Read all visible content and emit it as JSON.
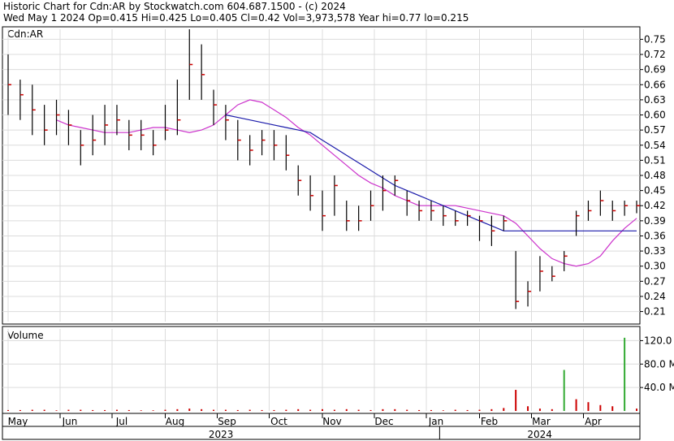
{
  "header": {
    "line1": "Historic Chart for Cdn:AR by Stockwatch.com 604.687.1500 - (c) 2024",
    "line2": "Wed May  1 2024   Op=0.415  Hi=0.425  Lo=0.405  Cl=0.42  Vol=3,973,578  Year hi=0.77  lo=0.215"
  },
  "price_panel": {
    "label": "Cdn:AR"
  },
  "volume_panel": {
    "label": "Volume"
  },
  "colors": {
    "bar_up": "#000000",
    "close_tick": "#cc0000",
    "ma_short": "#cc33cc",
    "ma_long": "#1a1aaa",
    "volume_bar": "#cc0000",
    "volume_spike": "#33aa33",
    "grid": "#dcdcdc"
  },
  "chart_data": [
    {
      "type": "ohlc",
      "title": "Historic Chart for Cdn:AR",
      "ylim": [
        0.19,
        0.77
      ],
      "yticks": [
        0.21,
        0.24,
        0.27,
        0.3,
        0.33,
        0.36,
        0.39,
        0.42,
        0.45,
        0.48,
        0.51,
        0.54,
        0.57,
        0.6,
        0.63,
        0.66,
        0.69,
        0.72,
        0.75
      ],
      "ytick_labels": [
        "0.21",
        "0.24",
        "0.27",
        "0.30",
        "0.33",
        "0.36",
        "0.39",
        "0.42",
        "0.45",
        "0.48",
        "0.51",
        "0.54",
        "0.57",
        "0.60",
        "0.63",
        "0.66",
        "0.69",
        "0.72",
        "0.75"
      ],
      "x_months": [
        "May",
        "Jun",
        "Jul",
        "Aug",
        "Sep",
        "Oct",
        "Nov",
        "Dec",
        "Jan",
        "Feb",
        "Mar",
        "Apr"
      ],
      "x_years": [
        "2023",
        "2024"
      ],
      "grid": true,
      "series": [
        {
          "role": "close",
          "weeks": [
            "2023-05-01",
            "2023-05-08",
            "2023-05-15",
            "2023-05-22",
            "2023-05-29",
            "2023-06-05",
            "2023-06-12",
            "2023-06-19",
            "2023-06-26",
            "2023-07-03",
            "2023-07-10",
            "2023-07-17",
            "2023-07-24",
            "2023-07-31",
            "2023-08-07",
            "2023-08-14",
            "2023-08-21",
            "2023-08-28",
            "2023-09-04",
            "2023-09-11",
            "2023-09-18",
            "2023-09-25",
            "2023-10-02",
            "2023-10-09",
            "2023-10-16",
            "2023-10-23",
            "2023-10-30",
            "2023-11-06",
            "2023-11-13",
            "2023-11-20",
            "2023-11-27",
            "2023-12-04",
            "2023-12-11",
            "2023-12-18",
            "2023-12-25",
            "2024-01-01",
            "2024-01-08",
            "2024-01-15",
            "2024-01-22",
            "2024-01-29",
            "2024-02-05",
            "2024-02-12",
            "2024-02-19",
            "2024-02-26",
            "2024-03-04",
            "2024-03-11",
            "2024-03-18",
            "2024-03-25",
            "2024-04-01",
            "2024-04-08",
            "2024-04-15",
            "2024-04-22",
            "2024-04-29"
          ],
          "close": [
            0.66,
            0.64,
            0.61,
            0.57,
            0.6,
            0.58,
            0.54,
            0.55,
            0.58,
            0.59,
            0.56,
            0.56,
            0.54,
            0.57,
            0.59,
            0.7,
            0.68,
            0.62,
            0.59,
            0.55,
            0.53,
            0.55,
            0.54,
            0.52,
            0.47,
            0.44,
            0.4,
            0.46,
            0.39,
            0.39,
            0.42,
            0.45,
            0.47,
            0.43,
            0.41,
            0.41,
            0.4,
            0.39,
            0.4,
            0.39,
            0.37,
            0.39,
            0.23,
            0.25,
            0.29,
            0.28,
            0.32,
            0.4,
            0.41,
            0.43,
            0.41,
            0.42,
            0.42
          ],
          "high": [
            0.72,
            0.67,
            0.66,
            0.62,
            0.63,
            0.61,
            0.57,
            0.6,
            0.62,
            0.62,
            0.59,
            0.59,
            0.57,
            0.62,
            0.67,
            0.77,
            0.74,
            0.65,
            0.62,
            0.59,
            0.56,
            0.57,
            0.57,
            0.56,
            0.5,
            0.48,
            0.45,
            0.48,
            0.43,
            0.42,
            0.45,
            0.48,
            0.48,
            0.45,
            0.43,
            0.43,
            0.42,
            0.41,
            0.41,
            0.4,
            0.4,
            0.4,
            0.33,
            0.27,
            0.32,
            0.3,
            0.33,
            0.41,
            0.43,
            0.45,
            0.43,
            0.43,
            0.43
          ],
          "low": [
            0.6,
            0.59,
            0.56,
            0.54,
            0.56,
            0.54,
            0.5,
            0.52,
            0.54,
            0.56,
            0.53,
            0.53,
            0.52,
            0.55,
            0.56,
            0.63,
            0.63,
            0.58,
            0.55,
            0.51,
            0.5,
            0.52,
            0.51,
            0.49,
            0.44,
            0.41,
            0.37,
            0.4,
            0.37,
            0.37,
            0.39,
            0.41,
            0.44,
            0.4,
            0.39,
            0.39,
            0.38,
            0.38,
            0.38,
            0.35,
            0.34,
            0.37,
            0.215,
            0.22,
            0.25,
            0.27,
            0.29,
            0.36,
            0.39,
            0.4,
            0.39,
            0.4,
            0.405
          ]
        },
        {
          "role": "ma_short",
          "weeks_from_index": 4,
          "values": [
            0.59,
            0.58,
            0.575,
            0.57,
            0.565,
            0.565,
            0.565,
            0.57,
            0.575,
            0.575,
            0.57,
            0.565,
            0.57,
            0.58,
            0.6,
            0.62,
            0.63,
            0.625,
            0.61,
            0.595,
            0.575,
            0.56,
            0.54,
            0.52,
            0.5,
            0.48,
            0.465,
            0.455,
            0.44,
            0.43,
            0.42,
            0.42,
            0.42,
            0.42,
            0.415,
            0.41,
            0.405,
            0.4,
            0.385,
            0.36,
            0.335,
            0.315,
            0.305,
            0.3,
            0.305,
            0.32,
            0.35,
            0.375,
            0.395
          ]
        },
        {
          "role": "ma_long",
          "weeks_from_index": 18,
          "values": [
            0.6,
            0.595,
            0.59,
            0.585,
            0.58,
            0.575,
            0.57,
            0.565,
            0.55,
            0.535,
            0.52,
            0.505,
            0.49,
            0.475,
            0.46,
            0.45,
            0.44,
            0.43,
            0.42,
            0.41,
            0.4,
            0.39,
            0.38,
            0.37,
            0.37,
            0.37,
            0.37,
            0.37,
            0.37,
            0.37,
            0.37,
            0.37,
            0.37,
            0.37,
            0.37
          ]
        }
      ]
    },
    {
      "type": "bar",
      "title": "Volume",
      "ylim": [
        0,
        140
      ],
      "yticks": [
        40,
        80,
        120
      ],
      "ytick_labels": [
        "40.0 M",
        "80.0 M",
        "120.0 M"
      ],
      "values": [
        1.5,
        1.5,
        2,
        2,
        1,
        2,
        2,
        1.5,
        1.5,
        2,
        1.5,
        1,
        1,
        2,
        3,
        4,
        3,
        2,
        2,
        1.5,
        2,
        1.5,
        1.5,
        2,
        3,
        2,
        3,
        2,
        3,
        2,
        1.5,
        3,
        3,
        2,
        1.5,
        1.5,
        1,
        2,
        1.5,
        2,
        3,
        5,
        36,
        8,
        4,
        3,
        70,
        20,
        15,
        10,
        8,
        125,
        4
      ]
    }
  ]
}
